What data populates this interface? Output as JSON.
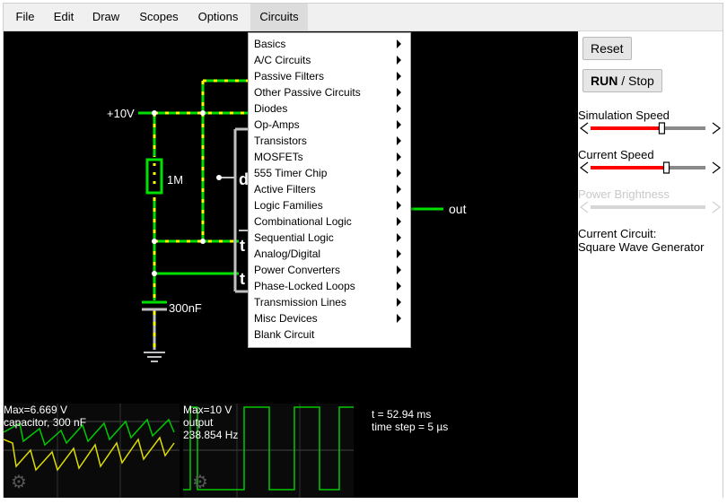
{
  "menubar": {
    "items": [
      {
        "label": "File"
      },
      {
        "label": "Edit"
      },
      {
        "label": "Draw"
      },
      {
        "label": "Scopes"
      },
      {
        "label": "Options"
      },
      {
        "label": "Circuits"
      }
    ],
    "active": "Circuits"
  },
  "circuits_menu": {
    "items": [
      {
        "label": "Basics",
        "submenu": true
      },
      {
        "label": "A/C Circuits",
        "submenu": true
      },
      {
        "label": "Passive Filters",
        "submenu": true
      },
      {
        "label": "Other Passive Circuits",
        "submenu": true
      },
      {
        "label": "Diodes",
        "submenu": true
      },
      {
        "label": "Op-Amps",
        "submenu": true
      },
      {
        "label": "Transistors",
        "submenu": true
      },
      {
        "label": "MOSFETs",
        "submenu": true
      },
      {
        "label": "555 Timer Chip",
        "submenu": true
      },
      {
        "label": "Active Filters",
        "submenu": true
      },
      {
        "label": "Logic Families",
        "submenu": true
      },
      {
        "label": "Combinational Logic",
        "submenu": true
      },
      {
        "label": "Sequential Logic",
        "submenu": true
      },
      {
        "label": "Analog/Digital",
        "submenu": true
      },
      {
        "label": "Power Converters",
        "submenu": true
      },
      {
        "label": "Phase-Locked Loops",
        "submenu": true
      },
      {
        "label": "Transmission Lines",
        "submenu": true
      },
      {
        "label": "Misc Devices",
        "submenu": true
      },
      {
        "label": "Blank Circuit",
        "submenu": false
      }
    ]
  },
  "circuit": {
    "voltage_label": "+10V",
    "resistor_label": "1M",
    "capacitor_label": "300nF",
    "output_label": "out",
    "chip_pin_d": "d",
    "chip_pin_t1": "t",
    "chip_pin_t2": "t"
  },
  "scopes": {
    "scope1": {
      "max": "Max=6.669 V",
      "label": "capacitor, 300 nF"
    },
    "scope2": {
      "max": "Max=10 V",
      "label": "output",
      "freq": "238.854 Hz"
    },
    "info": {
      "time": "t = 52.94 ms",
      "step": "time step = 5 µs"
    }
  },
  "sidebar": {
    "reset_label": "Reset",
    "run_label_bold": "RUN",
    "run_label_rest": " / Stop",
    "sim_speed_label": "Simulation Speed",
    "current_speed_label": "Current Speed",
    "power_brightness_label": "Power Brightness",
    "current_circuit_label": "Current Circuit:",
    "current_circuit_name": "Square Wave Generator",
    "sim_speed_value": 0.62,
    "current_speed_value": 0.66
  },
  "colors": {
    "wire_green": "#00e000",
    "current_yellow": "#ffff00",
    "slider_red": "#ff0000",
    "slider_gray": "#8a8a8a",
    "scope_yellow": "#dcdc00",
    "scope_green": "#00c800"
  }
}
